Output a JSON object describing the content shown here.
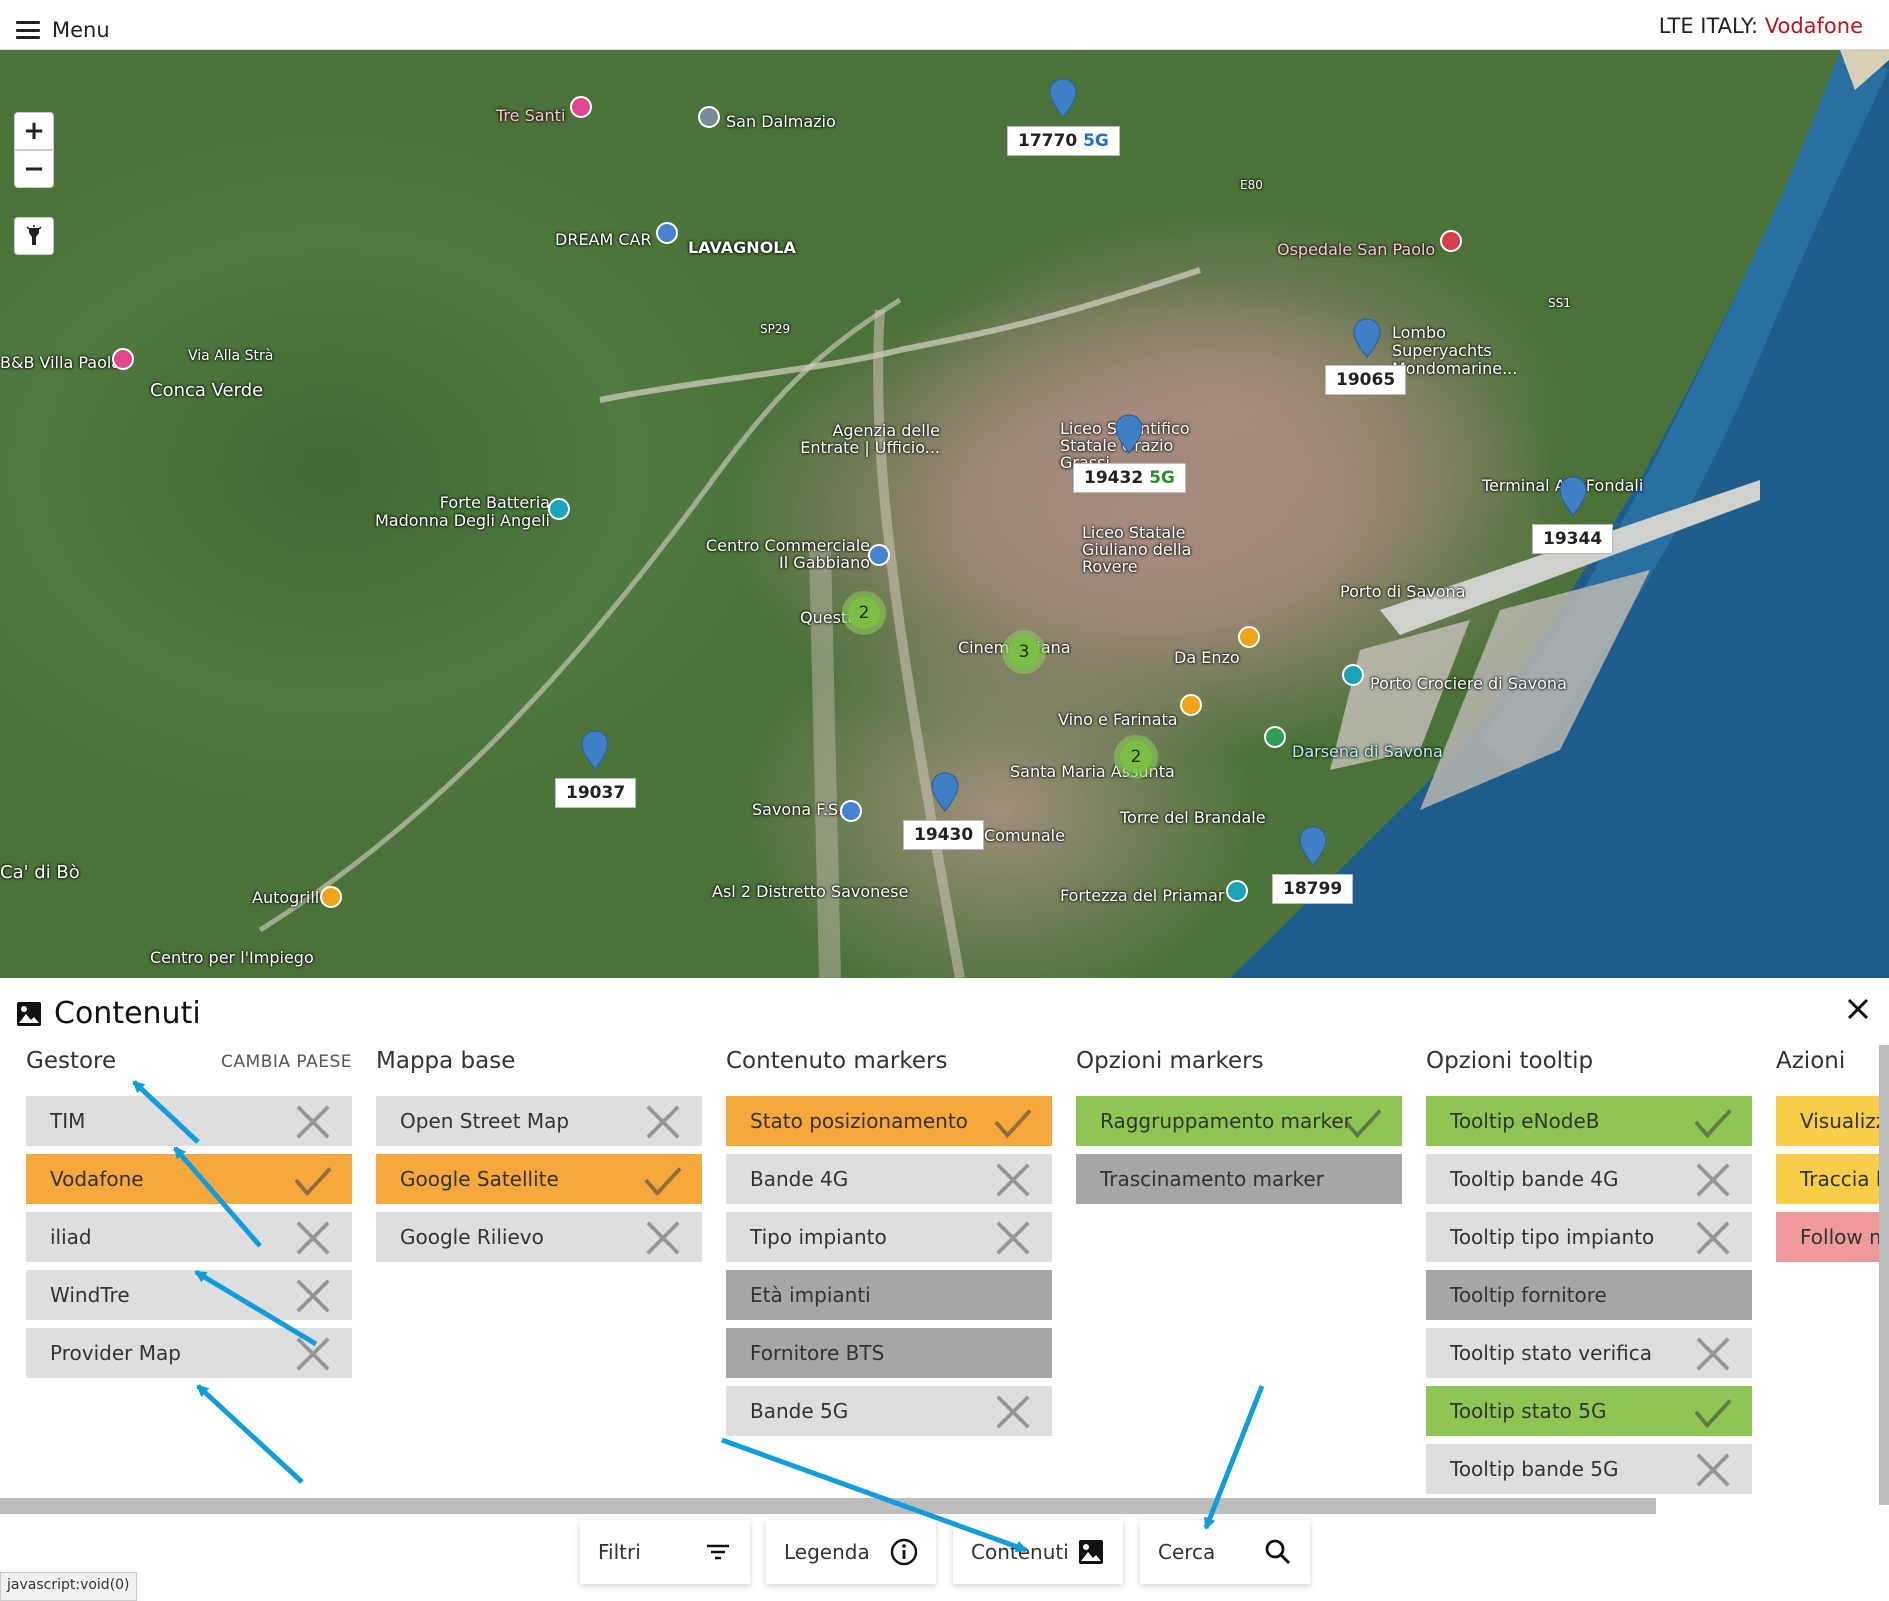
{
  "topbar": {
    "menu_label": "Menu",
    "brand_prefix": "LTE ITALY: ",
    "brand_operator": "Vodafone"
  },
  "map": {
    "zoom_in": "+",
    "zoom_out": "−",
    "markers": [
      {
        "id": "17770",
        "tech": "5G"
      },
      {
        "id": "19065",
        "tech": ""
      },
      {
        "id": "19432",
        "tech": "5G"
      },
      {
        "id": "19344",
        "tech": ""
      },
      {
        "id": "19037",
        "tech": ""
      },
      {
        "id": "19430",
        "tech": ""
      },
      {
        "id": "18799",
        "tech": ""
      }
    ],
    "clusters": [
      "2",
      "3",
      "2"
    ],
    "places": [
      "Tre Santi",
      "San Dalmazio",
      "DREAM CAR",
      "LAVAGNOLA",
      "Ospedale San Paolo",
      "Lombo Superyachts Mondomarine...",
      "B&B Villa Paola",
      "Conca Verde",
      "Via Alla Strà",
      "Agenzia delle Entrate | Ufficio...",
      "Liceo Scientifico Statale Orazio Grassi",
      "Forte Batteria Madonna Degli Angeli",
      "Centro Commerciale Il Gabbiano",
      "Liceo Statale Giuliano della Rovere",
      "Terminal Alti Fondali",
      "Porto di Savona",
      "Questura",
      "Cinema Diana",
      "Da Enzo",
      "Porto Crociere di Savona",
      "Vino e Farinata",
      "Darsena di Savona",
      "Santa Maria Assunta",
      "Savona F.S.",
      "Torre del Brandale",
      "Comunale",
      "Ca' di Bò",
      "Autogrill",
      "Asl 2 Distretto Savonese",
      "Fortezza del Priamar",
      "Centro per l'Impiego",
      "SP29",
      "E80",
      "SS1"
    ]
  },
  "panel": {
    "title": "Contenuti",
    "columns": [
      {
        "title": "Gestore",
        "action": "CAMBIA PAESE",
        "options": [
          {
            "label": "TIM",
            "state": "off"
          },
          {
            "label": "Vodafone",
            "state": "orange"
          },
          {
            "label": "iliad",
            "state": "off"
          },
          {
            "label": "WindTre",
            "state": "off"
          },
          {
            "label": "Provider Map",
            "state": "off"
          }
        ]
      },
      {
        "title": "Mappa base",
        "options": [
          {
            "label": "Open Street Map",
            "state": "off"
          },
          {
            "label": "Google Satellite",
            "state": "orange"
          },
          {
            "label": "Google Rilievo",
            "state": "off"
          }
        ]
      },
      {
        "title": "Contenuto markers",
        "options": [
          {
            "label": "Stato posizionamento",
            "state": "orange"
          },
          {
            "label": "Bande 4G",
            "state": "off"
          },
          {
            "label": "Tipo impianto",
            "state": "off"
          },
          {
            "label": "Età impianti",
            "state": "dark"
          },
          {
            "label": "Fornitore BTS",
            "state": "dark"
          },
          {
            "label": "Bande 5G",
            "state": "off"
          }
        ]
      },
      {
        "title": "Opzioni markers",
        "options": [
          {
            "label": "Raggruppamento marker",
            "state": "green"
          },
          {
            "label": "Trascinamento marker",
            "state": "dark"
          }
        ]
      },
      {
        "title": "Opzioni tooltip",
        "options": [
          {
            "label": "Tooltip eNodeB",
            "state": "green"
          },
          {
            "label": "Tooltip bande 4G",
            "state": "off"
          },
          {
            "label": "Tooltip tipo impianto",
            "state": "off"
          },
          {
            "label": "Tooltip fornitore",
            "state": "dark"
          },
          {
            "label": "Tooltip stato verifica",
            "state": "off"
          },
          {
            "label": "Tooltip stato 5G",
            "state": "green"
          },
          {
            "label": "Tooltip bande 5G",
            "state": "off"
          }
        ]
      },
      {
        "title": "Azioni",
        "options": [
          {
            "label": "Visualizz",
            "state": "yellow"
          },
          {
            "label": "Traccia l",
            "state": "yellow"
          },
          {
            "label": "Follow m",
            "state": "red"
          }
        ]
      }
    ]
  },
  "tabs": [
    {
      "label": "Filtri",
      "icon": "filter-icon"
    },
    {
      "label": "Legenda",
      "icon": "info-icon"
    },
    {
      "label": "Contenuti",
      "icon": "image-icon"
    },
    {
      "label": "Cerca",
      "icon": "search-icon"
    }
  ],
  "statusbar": "javascript:void(0)",
  "colors": {
    "orange": "#f6a83c",
    "green": "#8dc652",
    "off": "#dedede",
    "dark": "#a6a6a6",
    "yellow": "#f7cd4a",
    "red": "#ee9a9a",
    "brand": "#c2121c",
    "arrow": "#0f9ddc"
  }
}
